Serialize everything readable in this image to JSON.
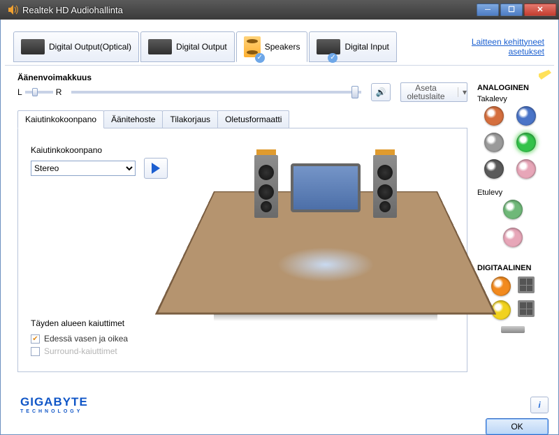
{
  "window": {
    "title": "Realtek HD Audiohallinta"
  },
  "top_link": {
    "l1": "Laitteen kehittyneet",
    "l2": "asetukset"
  },
  "device_tabs": [
    {
      "label": "Digital Output(Optical)"
    },
    {
      "label": "Digital Output"
    },
    {
      "label": "Speakers"
    },
    {
      "label": "Digital Input"
    }
  ],
  "volume": {
    "heading": "Äänenvoimakkuus",
    "l": "L",
    "r": "R",
    "default_button": "Aseta oletuslaite"
  },
  "inner_tabs": {
    "t1": "Kaiutinkokoonpano",
    "t2": "Äänitehoste",
    "t3": "Tilakorjaus",
    "t4": "Oletusformaatti"
  },
  "config": {
    "label": "Kaiutinkokoonpano",
    "value": "Stereo"
  },
  "full_range": {
    "heading": "Täyden alueen kaiuttimet",
    "opt1": "Edessä vasen ja oikea",
    "opt2": "Surround-kaiuttimet"
  },
  "side": {
    "analog": "ANALOGINEN",
    "back": "Takalevy",
    "front": "Etulevy",
    "digital": "DIGITAALINEN",
    "jacks_back": [
      {
        "color": "#d56f3e"
      },
      {
        "color": "#4a74c7"
      },
      {
        "color": "#9a9a9a"
      },
      {
        "color": "#34c24a",
        "active": true
      },
      {
        "color": "#5a5a5a"
      },
      {
        "color": "#e7a6b8"
      }
    ],
    "jacks_front": [
      {
        "color": "#6fb878"
      },
      {
        "color": "#e7a6b8"
      }
    ],
    "dig_jacks": [
      {
        "color": "#f28a1e"
      },
      {
        "color": "#f1d21e"
      }
    ]
  },
  "footer": {
    "brand": "GIGABYTE",
    "brand_sub": "TECHNOLOGY",
    "ok": "OK"
  }
}
